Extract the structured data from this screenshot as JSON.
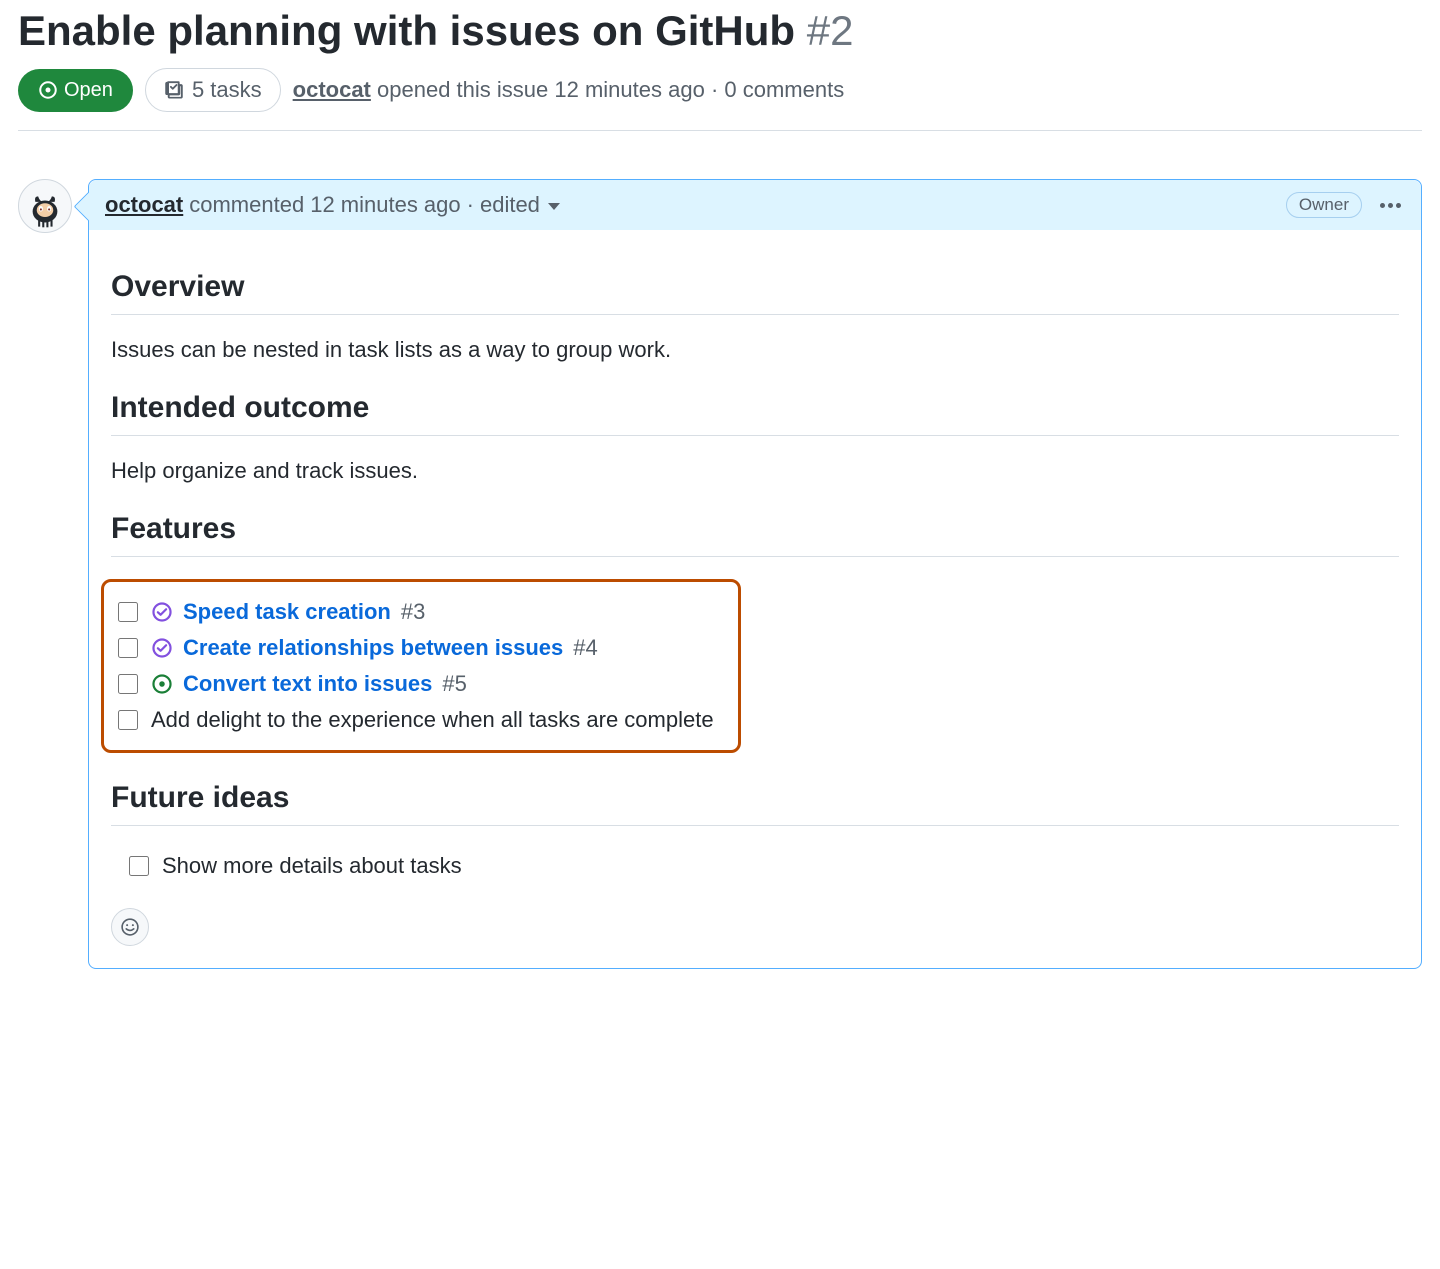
{
  "issue": {
    "title": "Enable planning with issues on GitHub",
    "number": "#2",
    "state": "Open",
    "tasks_label": "5 tasks",
    "meta": {
      "author": "octocat",
      "opened_text": "opened this issue",
      "time_ago": "12 minutes ago",
      "comments": "0 comments"
    }
  },
  "comment": {
    "author": "octocat",
    "commented_text": "commented",
    "time_ago": "12 minutes ago",
    "edited_label": "edited",
    "role_badge": "Owner",
    "sections": {
      "overview": {
        "heading": "Overview",
        "text": "Issues can be nested in task lists as a way to group work."
      },
      "outcome": {
        "heading": "Intended outcome",
        "text": "Help organize and track issues."
      },
      "features": {
        "heading": "Features",
        "items": [
          {
            "label": "Speed task creation",
            "ref": "#3",
            "status": "closed"
          },
          {
            "label": "Create relationships between issues",
            "ref": "#4",
            "status": "closed"
          },
          {
            "label": "Convert text into issues",
            "ref": "#5",
            "status": "open"
          },
          {
            "label": "Add delight to the experience when all tasks are complete",
            "ref": "",
            "status": "none"
          }
        ]
      },
      "future": {
        "heading": "Future ideas",
        "items": [
          {
            "label": "Show more details about tasks"
          }
        ]
      }
    }
  }
}
